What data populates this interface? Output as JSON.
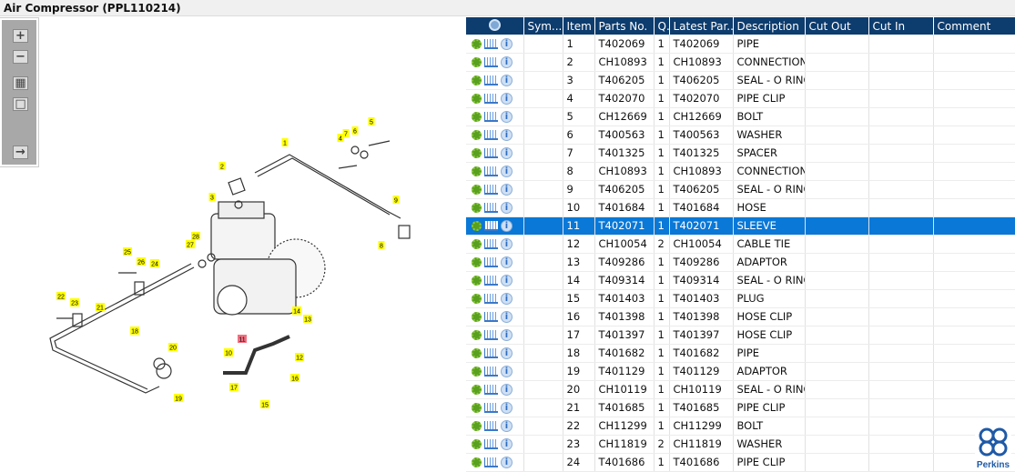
{
  "window": {
    "title": "Air Compressor (PPL110214)"
  },
  "toolbar": {
    "zoom_in": "+",
    "zoom_out": "−",
    "fit": "▦",
    "actual": "□",
    "export": "→"
  },
  "grid": {
    "columns": [
      "",
      "Sym...",
      "Item",
      "Parts No.",
      "Q.",
      "Latest Par...",
      "Description",
      "Cut Out",
      "Cut In",
      "Comment"
    ],
    "selected_item": "11",
    "rows": [
      [
        "1",
        "T402069",
        "1",
        "T402069",
        "PIPE"
      ],
      [
        "2",
        "CH10893",
        "1",
        "CH10893",
        "CONNECTION"
      ],
      [
        "3",
        "T406205",
        "1",
        "T406205",
        "SEAL - O RING"
      ],
      [
        "4",
        "T402070",
        "1",
        "T402070",
        "PIPE CLIP"
      ],
      [
        "5",
        "CH12669",
        "1",
        "CH12669",
        "BOLT"
      ],
      [
        "6",
        "T400563",
        "1",
        "T400563",
        "WASHER"
      ],
      [
        "7",
        "T401325",
        "1",
        "T401325",
        "SPACER"
      ],
      [
        "8",
        "CH10893",
        "1",
        "CH10893",
        "CONNECTION"
      ],
      [
        "9",
        "T406205",
        "1",
        "T406205",
        "SEAL - O RING"
      ],
      [
        "10",
        "T401684",
        "1",
        "T401684",
        "HOSE"
      ],
      [
        "11",
        "T402071",
        "1",
        "T402071",
        "SLEEVE"
      ],
      [
        "12",
        "CH10054",
        "2",
        "CH10054",
        "CABLE TIE"
      ],
      [
        "13",
        "T409286",
        "1",
        "T409286",
        "ADAPTOR"
      ],
      [
        "14",
        "T409314",
        "1",
        "T409314",
        "SEAL - O RING"
      ],
      [
        "15",
        "T401403",
        "1",
        "T401403",
        "PLUG"
      ],
      [
        "16",
        "T401398",
        "1",
        "T401398",
        "HOSE CLIP"
      ],
      [
        "17",
        "T401397",
        "1",
        "T401397",
        "HOSE CLIP"
      ],
      [
        "18",
        "T401682",
        "1",
        "T401682",
        "PIPE"
      ],
      [
        "19",
        "T401129",
        "1",
        "T401129",
        "ADAPTOR"
      ],
      [
        "20",
        "CH10119",
        "1",
        "CH10119",
        "SEAL - O RING"
      ],
      [
        "21",
        "T401685",
        "1",
        "T401685",
        "PIPE CLIP"
      ],
      [
        "22",
        "CH11299",
        "1",
        "CH11299",
        "BOLT"
      ],
      [
        "23",
        "CH11819",
        "2",
        "CH11819",
        "WASHER"
      ],
      [
        "24",
        "T401686",
        "1",
        "T401686",
        "PIPE CLIP"
      ]
    ]
  },
  "diagram": {
    "callouts": [
      "1",
      "2",
      "3",
      "4",
      "5",
      "6",
      "7",
      "8",
      "9",
      "10",
      "11",
      "12",
      "13",
      "14",
      "15",
      "16",
      "17",
      "18",
      "19",
      "20",
      "21",
      "22",
      "23",
      "24",
      "25",
      "26",
      "27",
      "28"
    ],
    "highlight": "11"
  },
  "logo": {
    "text": "Perkins"
  },
  "colors": {
    "header": "#0d3c6e",
    "selection": "#0a78d7",
    "callout": "#ffff00",
    "callout_selected": "#f07080"
  }
}
